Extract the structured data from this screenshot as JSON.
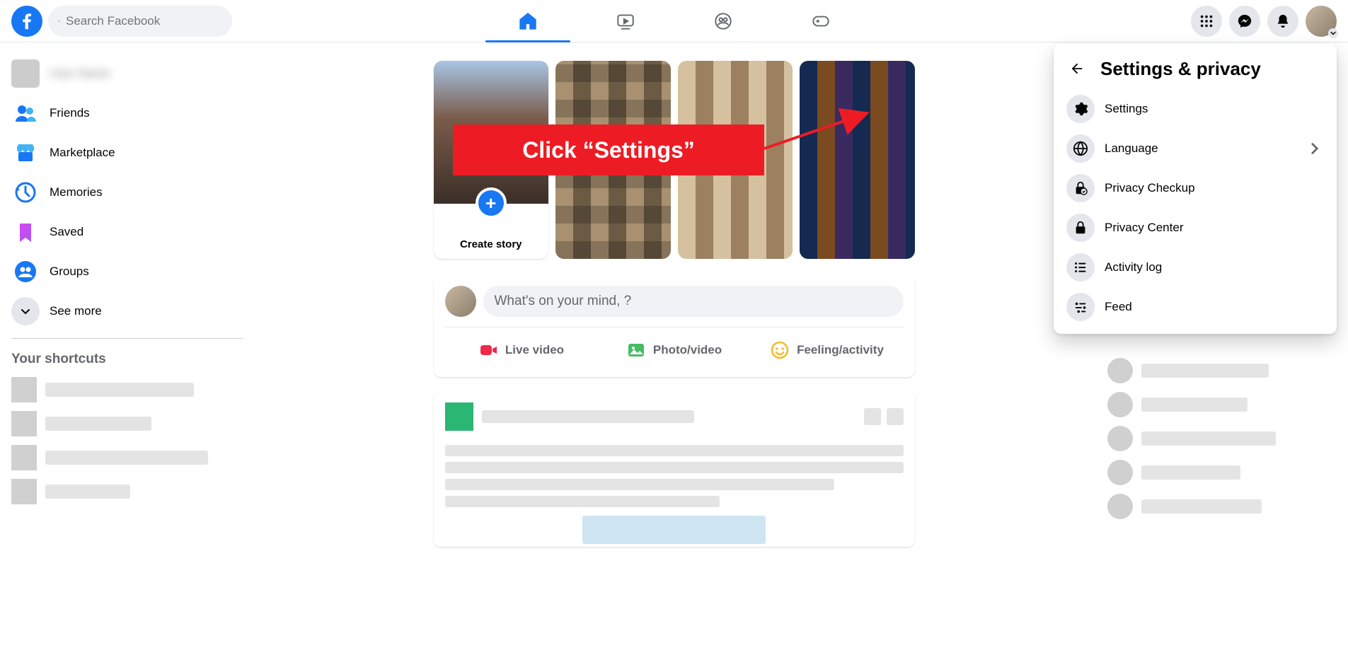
{
  "header": {
    "search_placeholder": "Search Facebook"
  },
  "sidebar": {
    "profile_name": "User Name",
    "items": [
      {
        "label": "Friends"
      },
      {
        "label": "Marketplace"
      },
      {
        "label": "Memories"
      },
      {
        "label": "Saved"
      },
      {
        "label": "Groups"
      }
    ],
    "see_more": "See more",
    "shortcuts_heading": "Your shortcuts"
  },
  "stories": {
    "create_label": "Create story"
  },
  "composer": {
    "placeholder": "What's on your mind,        ?",
    "actions": [
      {
        "label": "Live video"
      },
      {
        "label": "Photo/video"
      },
      {
        "label": "Feeling/activity"
      }
    ]
  },
  "dropdown": {
    "title": "Settings & privacy",
    "items": [
      {
        "label": "Settings",
        "has_chevron": false
      },
      {
        "label": "Language",
        "has_chevron": true
      },
      {
        "label": "Privacy Checkup",
        "has_chevron": false
      },
      {
        "label": "Privacy Center",
        "has_chevron": false
      },
      {
        "label": "Activity log",
        "has_chevron": false
      },
      {
        "label": "Feed",
        "has_chevron": false
      }
    ]
  },
  "annotation": {
    "text": "Click “Settings”"
  }
}
